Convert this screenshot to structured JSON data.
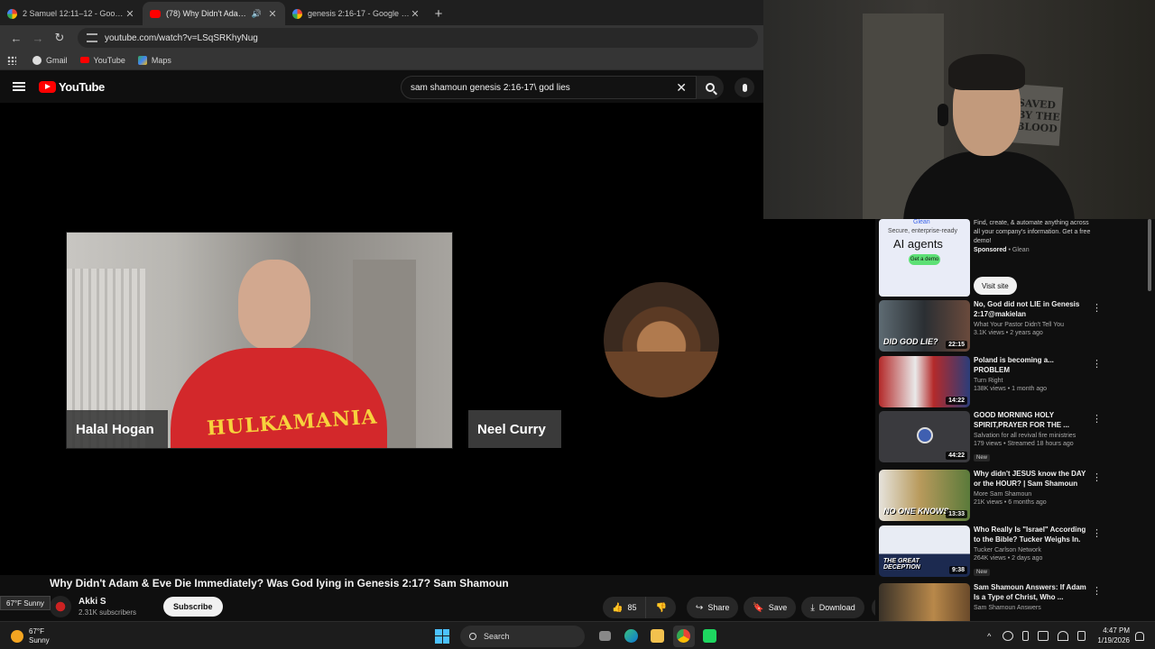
{
  "browser": {
    "tabs": [
      {
        "title": "2 Samuel 12:11–12 - Google Se",
        "favicon": "google",
        "active": false
      },
      {
        "title": "(78) Why Didn't Adam & Ev",
        "favicon": "youtube",
        "active": true,
        "audio": true
      },
      {
        "title": "genesis 2:16-17 - Google Searc",
        "favicon": "google",
        "active": false
      }
    ],
    "url": "youtube.com/watch?v=LSqSRKhyNug",
    "bookmarks": [
      "Gmail",
      "YouTube",
      "Maps"
    ]
  },
  "youtube": {
    "logo_text": "YouTube",
    "search_query": "sam shamoun genesis 2:16-17\\ god lies"
  },
  "video": {
    "participants": [
      {
        "name": "Halal Hogan",
        "shirt_text": "HULKAMANIA"
      },
      {
        "name": "Neel Curry"
      }
    ],
    "title": "Why Didn't Adam & Eve Die Immediately? Was God lying in Genesis 2:17? Sam Shamoun",
    "channel": "Akki S",
    "subscribers": "2.31K subscribers",
    "subscribe_label": "Subscribe",
    "likes": "85",
    "share_label": "Share",
    "save_label": "Save",
    "download_label": "Download"
  },
  "webcam": {
    "poster_text": "SAVED BY THE BLOOD"
  },
  "sidebar": {
    "ad": {
      "thumb_brand": "Glean",
      "thumb_tagline": "Secure, enterprise-ready",
      "thumb_headline": "AI agents",
      "thumb_cta": "Get a demo",
      "text": "Find, create, & automate anything across all your company's information. Get a free demo!",
      "sponsored": "Sponsored",
      "advertiser": "Glean",
      "visit_label": "Visit site"
    },
    "recommendations": [
      {
        "title": "No, God did not LIE in Genesis 2:17@makielan",
        "channel": "What Your Pastor Didn't Tell You",
        "meta": "3.1K views • 2 years ago",
        "duration": "22:15",
        "overlay": "DID GOD LIE?",
        "badge": ""
      },
      {
        "title": "Poland is becoming a... PROBLEM",
        "channel": "Turn Right",
        "meta": "138K views • 1 month ago",
        "duration": "14:22",
        "overlay": "",
        "badge": ""
      },
      {
        "title": "GOOD MORNING HOLY SPIRIT,PRAYER FOR THE ...",
        "channel": "Salvation for all revival fire ministries",
        "meta": "179 views • Streamed 18 hours ago",
        "duration": "44:22",
        "overlay": "",
        "badge": "New"
      },
      {
        "title": "Why didn't JESUS know the DAY or the HOUR? | Sam Shamoun",
        "channel": "More Sam Shamoun",
        "meta": "21K views • 6 months ago",
        "duration": "13:33",
        "overlay": "NO ONE KNOWS",
        "badge": ""
      },
      {
        "title": "Who Really Is \"Israel\" According to the Bible? Tucker Weighs In.",
        "channel": "Tucker Carlson Network",
        "meta": "264K views • 2 days ago",
        "duration": "9:38",
        "overlay": "THE GREAT DECEPTION",
        "badge": "New"
      },
      {
        "title": "Sam Shamoun Answers: If Adam Is a Type of Christ, Who ...",
        "channel": "Sam Shamoun Answers",
        "meta": "",
        "duration": "",
        "overlay": "",
        "badge": ""
      }
    ]
  },
  "taskbar": {
    "weather_tooltip": "67°F Sunny",
    "weather_temp": "67°F",
    "weather_cond": "Sunny",
    "search_label": "Search",
    "time": "4:47 PM",
    "date": "1/19/2026"
  }
}
